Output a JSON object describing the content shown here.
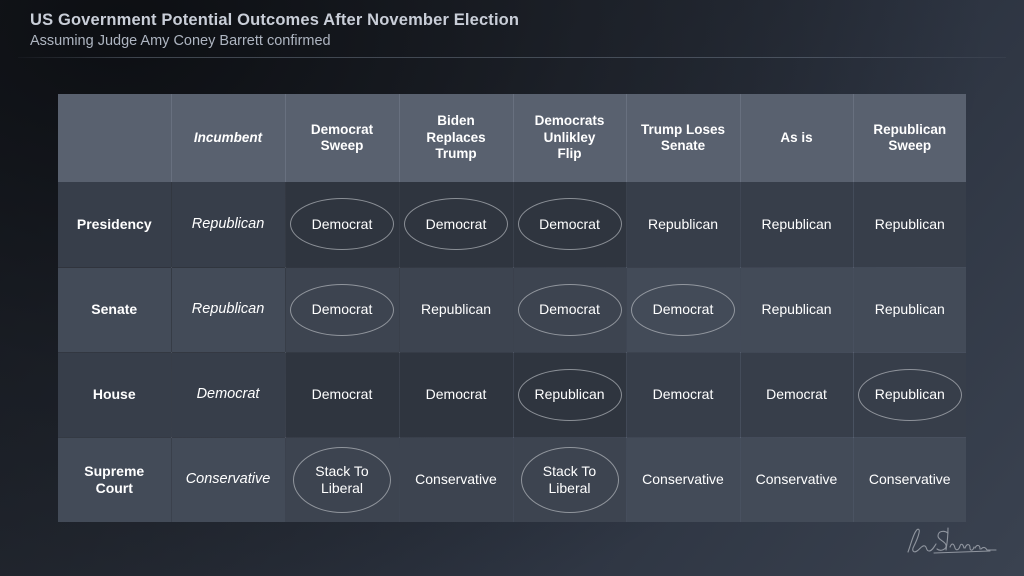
{
  "header": {
    "title": "US Government Potential Outcomes After November Election",
    "subtitle": "Assuming Judge Amy Coney Barrett confirmed"
  },
  "colors": {
    "background_dark": "#1a1e25",
    "background_light": "#3a4250",
    "table_header": "#59616f",
    "row_band_a": "#373e4a",
    "row_band_b": "#434b58",
    "cell_dim": "#2f353f",
    "text": "#ffffff",
    "title_text": "#c9ced8",
    "ring": "#c4c7cb"
  },
  "table": {
    "corner_label": "",
    "columns": [
      {
        "label": "Incumbent",
        "style": "italic",
        "dim": false
      },
      {
        "label": "Democrat\nSweep",
        "style": "bold",
        "dim": true
      },
      {
        "label": "Biden\nReplaces\nTrump",
        "style": "bold",
        "dim": true
      },
      {
        "label": "Democrats\nUnlikley\nFlip",
        "style": "bold",
        "dim": true
      },
      {
        "label": "Trump Loses\nSenate",
        "style": "bold",
        "dim": false
      },
      {
        "label": "As is",
        "style": "bold",
        "dim": false
      },
      {
        "label": "Republican\nSweep",
        "style": "bold",
        "dim": false
      }
    ],
    "rows": [
      {
        "label": "Presidency",
        "cells": [
          {
            "value": "Republican",
            "circled": false
          },
          {
            "value": "Democrat",
            "circled": true
          },
          {
            "value": "Democrat",
            "circled": true
          },
          {
            "value": "Democrat",
            "circled": true
          },
          {
            "value": "Republican",
            "circled": false
          },
          {
            "value": "Republican",
            "circled": false
          },
          {
            "value": "Republican",
            "circled": false
          }
        ]
      },
      {
        "label": "Senate",
        "cells": [
          {
            "value": "Republican",
            "circled": false
          },
          {
            "value": "Democrat",
            "circled": true
          },
          {
            "value": "Republican",
            "circled": false
          },
          {
            "value": "Democrat",
            "circled": true
          },
          {
            "value": "Democrat",
            "circled": true
          },
          {
            "value": "Republican",
            "circled": false
          },
          {
            "value": "Republican",
            "circled": false
          }
        ]
      },
      {
        "label": "House",
        "cells": [
          {
            "value": "Democrat",
            "circled": false
          },
          {
            "value": "Democrat",
            "circled": false
          },
          {
            "value": "Democrat",
            "circled": false
          },
          {
            "value": "Republican",
            "circled": true
          },
          {
            "value": "Democrat",
            "circled": false
          },
          {
            "value": "Democrat",
            "circled": false
          },
          {
            "value": "Republican",
            "circled": true
          }
        ]
      },
      {
        "label": "Supreme\nCourt",
        "cells": [
          {
            "value": "Conservative",
            "circled": false
          },
          {
            "value": "Stack To\nLiberal",
            "circled": true
          },
          {
            "value": "Conservative",
            "circled": false
          },
          {
            "value": "Stack To\nLiberal",
            "circled": true
          },
          {
            "value": "Conservative",
            "circled": false
          },
          {
            "value": "Conservative",
            "circled": false
          },
          {
            "value": "Conservative",
            "circled": false
          }
        ]
      }
    ]
  },
  "watermark": {
    "type": "signature",
    "name": "author-signature"
  }
}
